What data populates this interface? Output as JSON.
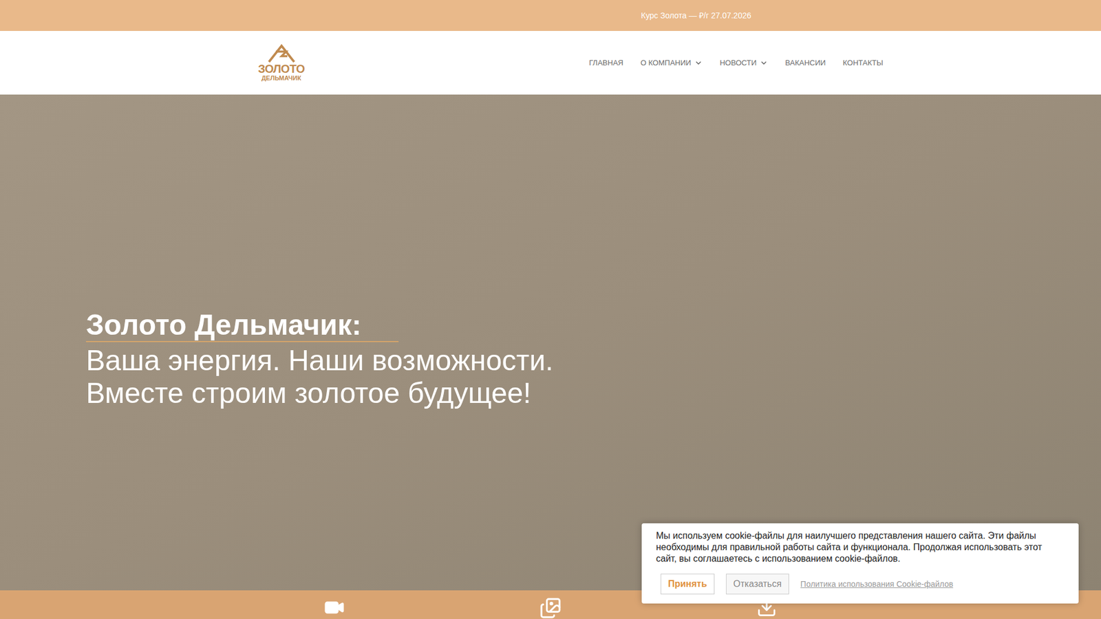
{
  "top_bar": {
    "text": "Курс Золота — ₽/г 27.07.2026"
  },
  "logo": {
    "lines": [
      "ЗОЛОТО",
      "ДЕЛЬМАЧИК"
    ]
  },
  "nav": {
    "items": [
      {
        "label": "ГЛАВНАЯ",
        "dropdown": false
      },
      {
        "label": "О КОМПАНИИ",
        "dropdown": true
      },
      {
        "label": "НОВОСТИ",
        "dropdown": true
      },
      {
        "label": "ВАКАНСИИ",
        "dropdown": false
      },
      {
        "label": "КОНТАКТЫ",
        "dropdown": false
      }
    ]
  },
  "hero": {
    "title": "Золото Дельмачик:",
    "subtitle": [
      "Ваша энергия. Наши возможности.",
      "Вместе строим золотое будущее!"
    ]
  },
  "cookie_banner": {
    "text": "Мы используем cookie-файлы для наилучшего представления нашего сайта. Эти файлы необходимы для правильной работы сайта и функционала. Продолжая использовать этот сайт, вы соглашаетесь с использованием cookie-файлов.",
    "accept": "Принять",
    "decline": "Отказаться",
    "policy_link": "Политика использования Cookie-файлов"
  }
}
